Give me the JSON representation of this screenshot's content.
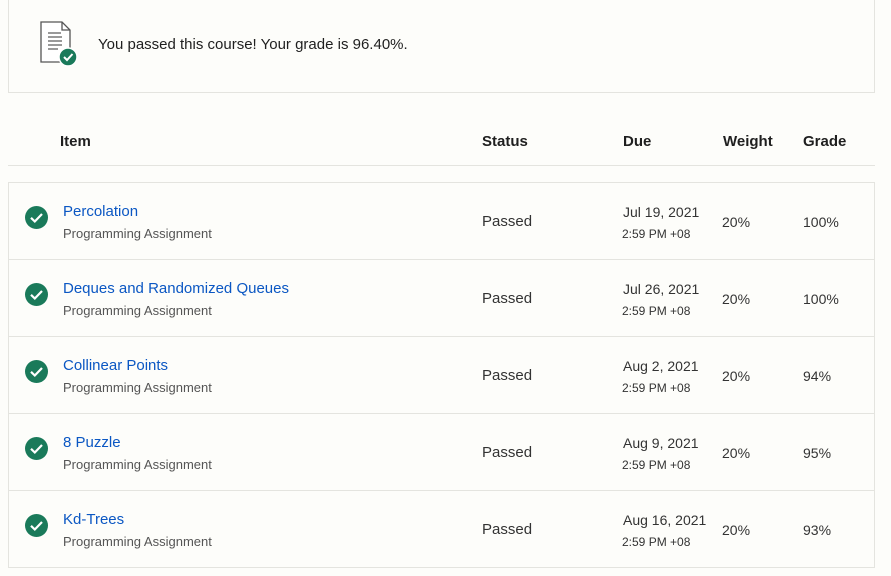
{
  "banner": {
    "message": "You passed this course! Your grade is 96.40%.",
    "icon": "document-check-icon"
  },
  "table": {
    "headers": {
      "item": "Item",
      "status": "Status",
      "due": "Due",
      "weight": "Weight",
      "grade": "Grade"
    },
    "rows": [
      {
        "name": "Percolation",
        "type": "Programming Assignment",
        "status": "Passed",
        "due_date": "Jul 19, 2021",
        "due_time": "2:59 PM +08",
        "weight": "20%",
        "grade": "100%"
      },
      {
        "name": "Deques and Randomized Queues",
        "type": "Programming Assignment",
        "status": "Passed",
        "due_date": "Jul 26, 2021",
        "due_time": "2:59 PM +08",
        "weight": "20%",
        "grade": "100%"
      },
      {
        "name": "Collinear Points",
        "type": "Programming Assignment",
        "status": "Passed",
        "due_date": "Aug 2, 2021",
        "due_time": "2:59 PM +08",
        "weight": "20%",
        "grade": "94%"
      },
      {
        "name": "8 Puzzle",
        "type": "Programming Assignment",
        "status": "Passed",
        "due_date": "Aug 9, 2021",
        "due_time": "2:59 PM +08",
        "weight": "20%",
        "grade": "95%"
      },
      {
        "name": "Kd-Trees",
        "type": "Programming Assignment",
        "status": "Passed",
        "due_date": "Aug 16, 2021",
        "due_time": "2:59 PM +08",
        "weight": "20%",
        "grade": "93%"
      }
    ]
  },
  "colors": {
    "accent_green": "#1a7a5a",
    "link_blue": "#0b57c3"
  }
}
